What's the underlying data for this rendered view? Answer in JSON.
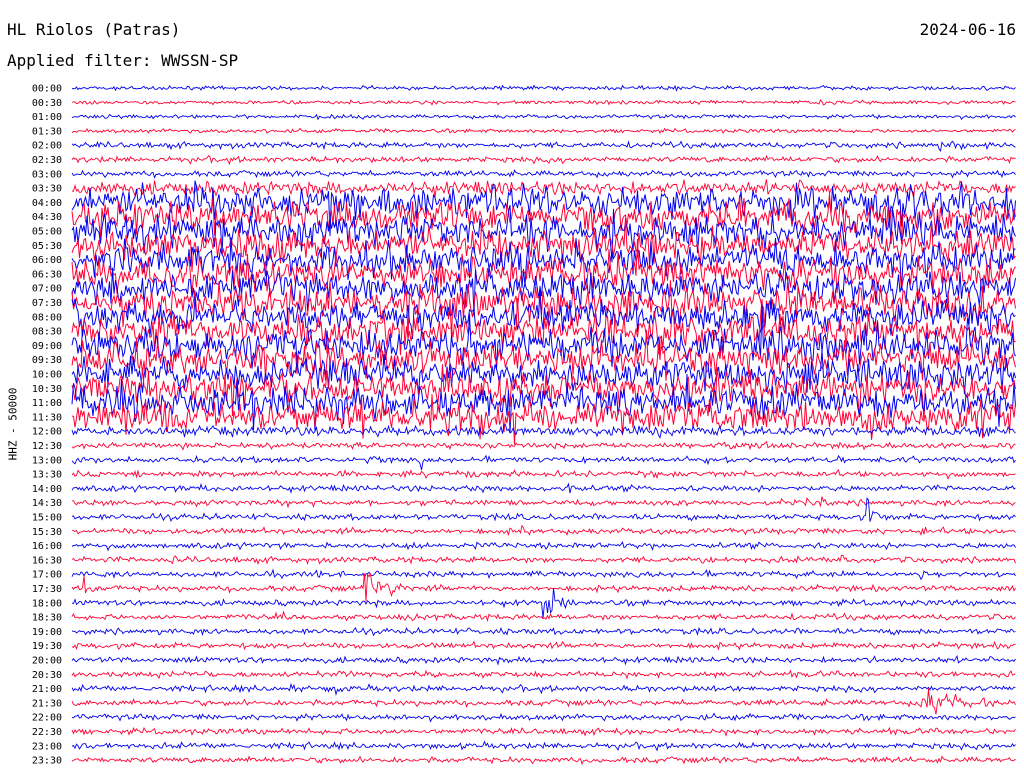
{
  "header": {
    "station": "HL Riolos (Patras)",
    "date": "2024-06-16",
    "filter": "Applied filter: WWSSN-SP"
  },
  "chart_data": {
    "type": "line",
    "subtype": "helicorder",
    "title": "HL Riolos (Patras)",
    "date": "2024-06-16",
    "filter": "Applied filter: WWSSN-SP",
    "ylabel": "HHZ - 50000",
    "row_minutes": 30,
    "trace_colors": [
      "#0000ee",
      "#ff0033"
    ],
    "tick_labels": [
      "00:00",
      "00:30",
      "01:00",
      "01:30",
      "02:00",
      "02:30",
      "03:00",
      "03:30",
      "04:00",
      "04:30",
      "05:00",
      "05:30",
      "06:00",
      "06:30",
      "07:00",
      "07:30",
      "08:00",
      "08:30",
      "09:00",
      "09:30",
      "10:00",
      "10:30",
      "11:00",
      "11:30",
      "12:00",
      "12:30",
      "13:00",
      "13:30",
      "14:00",
      "14:30",
      "15:00",
      "15:30",
      "16:00",
      "16:30",
      "17:00",
      "17:30",
      "18:00",
      "18:30",
      "19:00",
      "19:30",
      "20:00",
      "20:30",
      "21:00",
      "21:30",
      "22:00",
      "22:30",
      "23:00",
      "23:30"
    ],
    "noise_amplitude": [
      2,
      2,
      2,
      2,
      3,
      3,
      3,
      7,
      16,
      16,
      16,
      16,
      16,
      16,
      16,
      16,
      16,
      16,
      16,
      16,
      16,
      16,
      16,
      16,
      5,
      3,
      3,
      3,
      3,
      3,
      3,
      3,
      3,
      3,
      3,
      3,
      3,
      3,
      3,
      3,
      3,
      3,
      3,
      3,
      3,
      3,
      3,
      3
    ],
    "events": [
      {
        "time": "00:30",
        "offset_min": 23.9,
        "amplitude": 6,
        "duration_min": 1.0
      },
      {
        "time": "02:00",
        "offset_min": 27.5,
        "amplitude": 8,
        "duration_min": 2.5
      },
      {
        "time": "03:30",
        "offset_min": 0.5,
        "amplitude": 18,
        "duration_min": 0.8
      },
      {
        "time": "04:00",
        "offset_min": 6.4,
        "amplitude": 15,
        "duration_min": 1.2
      },
      {
        "time": "04:00",
        "offset_min": 22.1,
        "amplitude": 14,
        "duration_min": 1.6
      },
      {
        "time": "12:00",
        "offset_min": 2.8,
        "amplitude": 4,
        "duration_min": 1.2
      },
      {
        "time": "13:00",
        "offset_min": 9.4,
        "amplitude": 10,
        "duration_min": 1.2
      },
      {
        "time": "13:00",
        "offset_min": 11.1,
        "amplitude": 14,
        "duration_min": 0.5
      },
      {
        "time": "13:30",
        "offset_min": 18.5,
        "amplitude": 5,
        "duration_min": 1.0
      },
      {
        "time": "14:00",
        "offset_min": 4.1,
        "amplitude": 6,
        "duration_min": 1.5
      },
      {
        "time": "14:00",
        "offset_min": 12.5,
        "amplitude": 6,
        "duration_min": 0.8
      },
      {
        "time": "14:00",
        "offset_min": 15.7,
        "amplitude": 14,
        "duration_min": 0.4
      },
      {
        "time": "14:30",
        "offset_min": 23.8,
        "amplitude": 14,
        "duration_min": 0.3
      },
      {
        "time": "15:00",
        "offset_min": 25.3,
        "amplitude": 30,
        "duration_min": 0.9
      },
      {
        "time": "15:30",
        "offset_min": 14.3,
        "amplitude": 7,
        "duration_min": 0.4
      },
      {
        "time": "15:30",
        "offset_min": 27.0,
        "amplitude": 12,
        "duration_min": 0.4
      },
      {
        "time": "16:30",
        "offset_min": 3.2,
        "amplitude": 8,
        "duration_min": 0.5
      },
      {
        "time": "16:30",
        "offset_min": 19.8,
        "amplitude": 5,
        "duration_min": 1.0
      },
      {
        "time": "16:30",
        "offset_min": 24.5,
        "amplitude": 9,
        "duration_min": 0.4
      },
      {
        "time": "17:00",
        "offset_min": 6.2,
        "amplitude": 9,
        "duration_min": 0.6
      },
      {
        "time": "17:00",
        "offset_min": 22.1,
        "amplitude": 6,
        "duration_min": 0.4
      },
      {
        "time": "17:00",
        "offset_min": 26.9,
        "amplitude": 8,
        "duration_min": 0.8
      },
      {
        "time": "17:30",
        "offset_min": 0.4,
        "amplitude": 12,
        "duration_min": 0.6
      },
      {
        "time": "17:30",
        "offset_min": 9.3,
        "amplitude": 32,
        "duration_min": 1.6
      },
      {
        "time": "18:00",
        "offset_min": 15.0,
        "amplitude": 28,
        "duration_min": 1.0
      },
      {
        "time": "18:30",
        "offset_min": 6.5,
        "amplitude": 10,
        "duration_min": 0.8
      },
      {
        "time": "18:30",
        "offset_min": 10.6,
        "amplitude": 8,
        "duration_min": 1.0
      },
      {
        "time": "21:00",
        "offset_min": 7.0,
        "amplitude": 6,
        "duration_min": 1.5
      },
      {
        "time": "21:00",
        "offset_min": 8.4,
        "amplitude": 10,
        "duration_min": 0.5
      },
      {
        "time": "21:30",
        "offset_min": 27.0,
        "amplitude": 20,
        "duration_min": 2.8
      },
      {
        "time": "22:30",
        "offset_min": 17.3,
        "amplitude": 10,
        "duration_min": 0.8
      }
    ]
  }
}
